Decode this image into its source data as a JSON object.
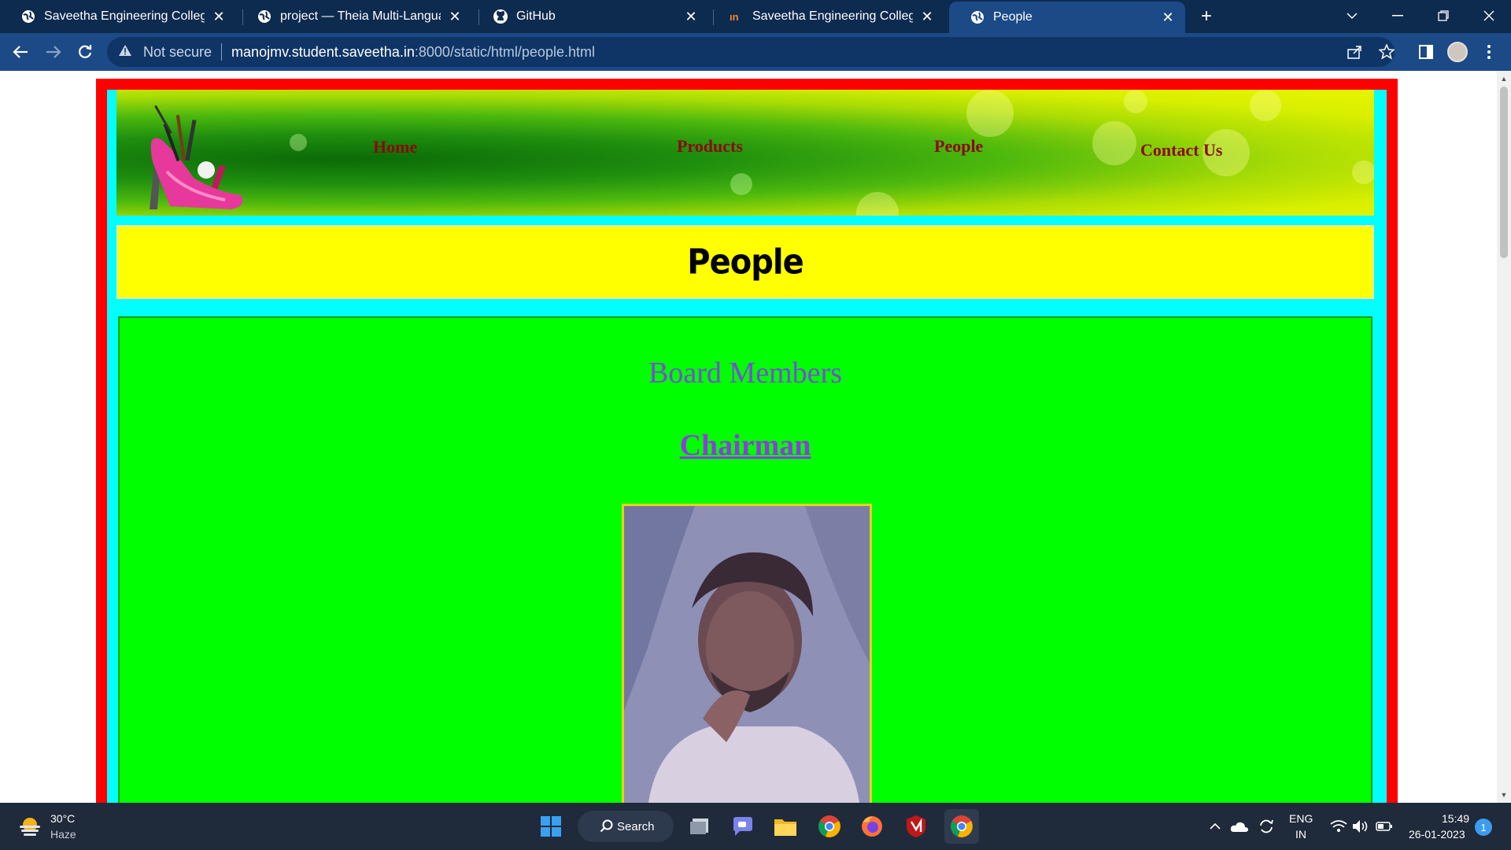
{
  "browser": {
    "tabs": [
      {
        "title": "Saveetha Engineering College",
        "icon": "globe-icon",
        "active": false
      },
      {
        "title": "project — Theia Multi-Language",
        "icon": "globe-icon",
        "active": false
      },
      {
        "title": "GitHub",
        "icon": "github-icon",
        "active": false
      },
      {
        "title": "Saveetha Engineering College",
        "icon": "saveetha-logo-icon",
        "active": false
      },
      {
        "title": "People",
        "icon": "globe-icon",
        "active": true
      }
    ],
    "new_tab_label": "+",
    "address": {
      "security_label": "Not secure",
      "url_host": "manojmv.student.saveetha.in",
      "url_path": ":8000/static/html/people.html"
    }
  },
  "page": {
    "nav": [
      "Home",
      "Products",
      "People",
      "Contact Us"
    ],
    "title": "People",
    "section_heading": "Board Members",
    "chairman_link": "Chairman",
    "colors": {
      "outer_border": "#ff0000",
      "inner_frame": "#00ffff",
      "title_bar": "#ffff00",
      "content_bg": "#00ff00",
      "nav_link": "#8b0a0a",
      "heading": "#7b4bd8"
    }
  },
  "taskbar": {
    "weather_temp": "30°C",
    "weather_desc": "Haze",
    "search_label": "Search",
    "lang_top": "ENG",
    "lang_bottom": "IN",
    "time": "15:49",
    "date": "26-01-2023",
    "notification_count": "1"
  }
}
